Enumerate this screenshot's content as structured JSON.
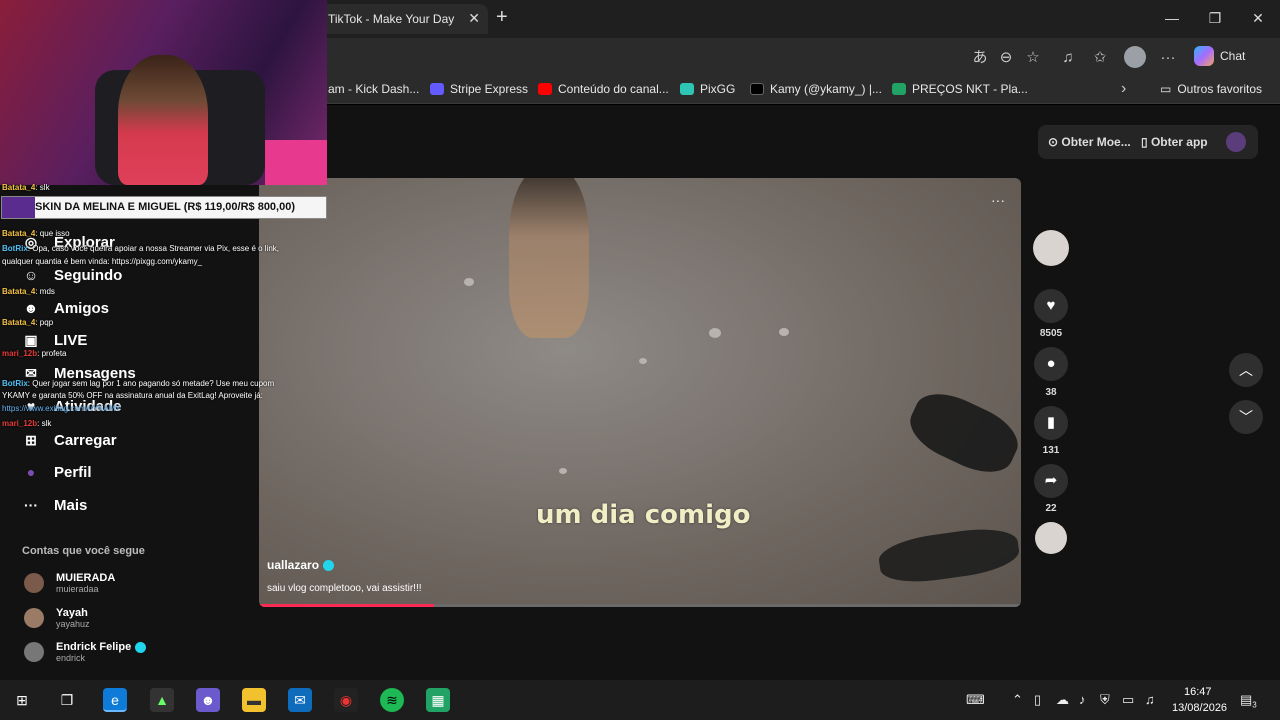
{
  "browser": {
    "tab_title": "TikTok - Make Your Day",
    "tab_close": "✕",
    "new_tab": "+",
    "chat_label": "Chat",
    "window_controls": {
      "minimize": "—",
      "maximize": "❐",
      "close": "✕"
    }
  },
  "favorites": [
    {
      "label": "am - Kick Dash...",
      "color": "#53fc18"
    },
    {
      "label": "Stripe Express",
      "color": "#635bff"
    },
    {
      "label": "Conteúdo do canal...",
      "color": "#ff0000"
    },
    {
      "label": "PixGG",
      "color": "#2ec4b6"
    },
    {
      "label": "Kamy (@ykamy_) |...",
      "color": "#000000"
    },
    {
      "label": "PREÇOS NKT - Pla...",
      "color": "#21a366"
    }
  ],
  "favorites_more": "›",
  "favorites_others": "Outros favoritos",
  "header_actions": {
    "get_coins": "Obter Moe...",
    "get_app": "Obter app"
  },
  "sidebar": {
    "items": [
      {
        "label": "Explorar",
        "icon": "compass-icon",
        "glyph": "◎"
      },
      {
        "label": "Seguindo",
        "icon": "following-icon",
        "glyph": "☺"
      },
      {
        "label": "Amigos",
        "icon": "friends-icon",
        "glyph": "☻"
      },
      {
        "label": "LIVE",
        "icon": "live-icon",
        "glyph": "▣"
      },
      {
        "label": "Mensagens",
        "icon": "message-icon",
        "glyph": "✉"
      },
      {
        "label": "Atividade",
        "icon": "activity-icon",
        "glyph": "♥"
      },
      {
        "label": "Carregar",
        "icon": "upload-icon",
        "glyph": "⊞"
      },
      {
        "label": "Perfil",
        "icon": "profile-icon",
        "glyph": "●"
      },
      {
        "label": "Mais",
        "icon": "more-icon",
        "glyph": "···"
      }
    ],
    "following_title": "Contas que você segue",
    "following": [
      {
        "name": "MUIERADA",
        "handle": "muieradaa",
        "verified": false,
        "color": "#7a5a4a"
      },
      {
        "name": "Yayah",
        "handle": "yayahuz",
        "verified": false,
        "color": "#9a7b66"
      },
      {
        "name": "Endrick Felipe",
        "handle": "endrick",
        "verified": true,
        "color": "#777777"
      }
    ]
  },
  "video": {
    "caption": "um dia comigo",
    "author": "uallazaro",
    "description": "saiu vlog completooo, vai assistir!!!",
    "more": "···",
    "progress": 0.23
  },
  "actions": {
    "likes": "8505",
    "comments": "38",
    "saves": "131",
    "shares": "22"
  },
  "stream_chat": [
    {
      "user": "Batata_4",
      "text": ": slk",
      "color": "#f5c242"
    },
    {
      "user": "Batata_4",
      "text": ": que isso",
      "color": "#f5c242"
    },
    {
      "user": "BotRix",
      "text": ": Opa, caso você queira apoiar a nossa Streamer via Pix, esse é o link,",
      "color": "#4fc3f7"
    },
    {
      "user": "",
      "text": "qualquer quantia é bem vinda: https://pixgg.com/ykamy_",
      "color": "#ffffff"
    },
    {
      "user": "Batata_4",
      "text": ": mds",
      "color": "#f5c242"
    },
    {
      "user": "Batata_4",
      "text": ": pqp",
      "color": "#f5c242"
    },
    {
      "user": "mari_12b",
      "text": ": profeta",
      "color": "#e53935"
    },
    {
      "user": "BotRix",
      "text": ": Quer jogar sem lag por 1 ano pagando só metade? Use meu cupom",
      "color": "#4fc3f7"
    },
    {
      "user": "",
      "text": "YKAMY e garanta 50% OFF na assinatura anual da ExitLag! Aproveite já:",
      "color": "#ffffff"
    },
    {
      "user": "",
      "text": "https://www.exitlag.com/r/YKAMY",
      "color": "#64b5f6"
    },
    {
      "user": "mari_12b",
      "text": ": slk",
      "color": "#e53935"
    }
  ],
  "banner": "SKIN DA MELINA E MIGUEL (R$ 119,00/R$ 800,00)",
  "taskbar": {
    "time": "16:47",
    "date": "13/08/2026",
    "notifications": "3"
  }
}
